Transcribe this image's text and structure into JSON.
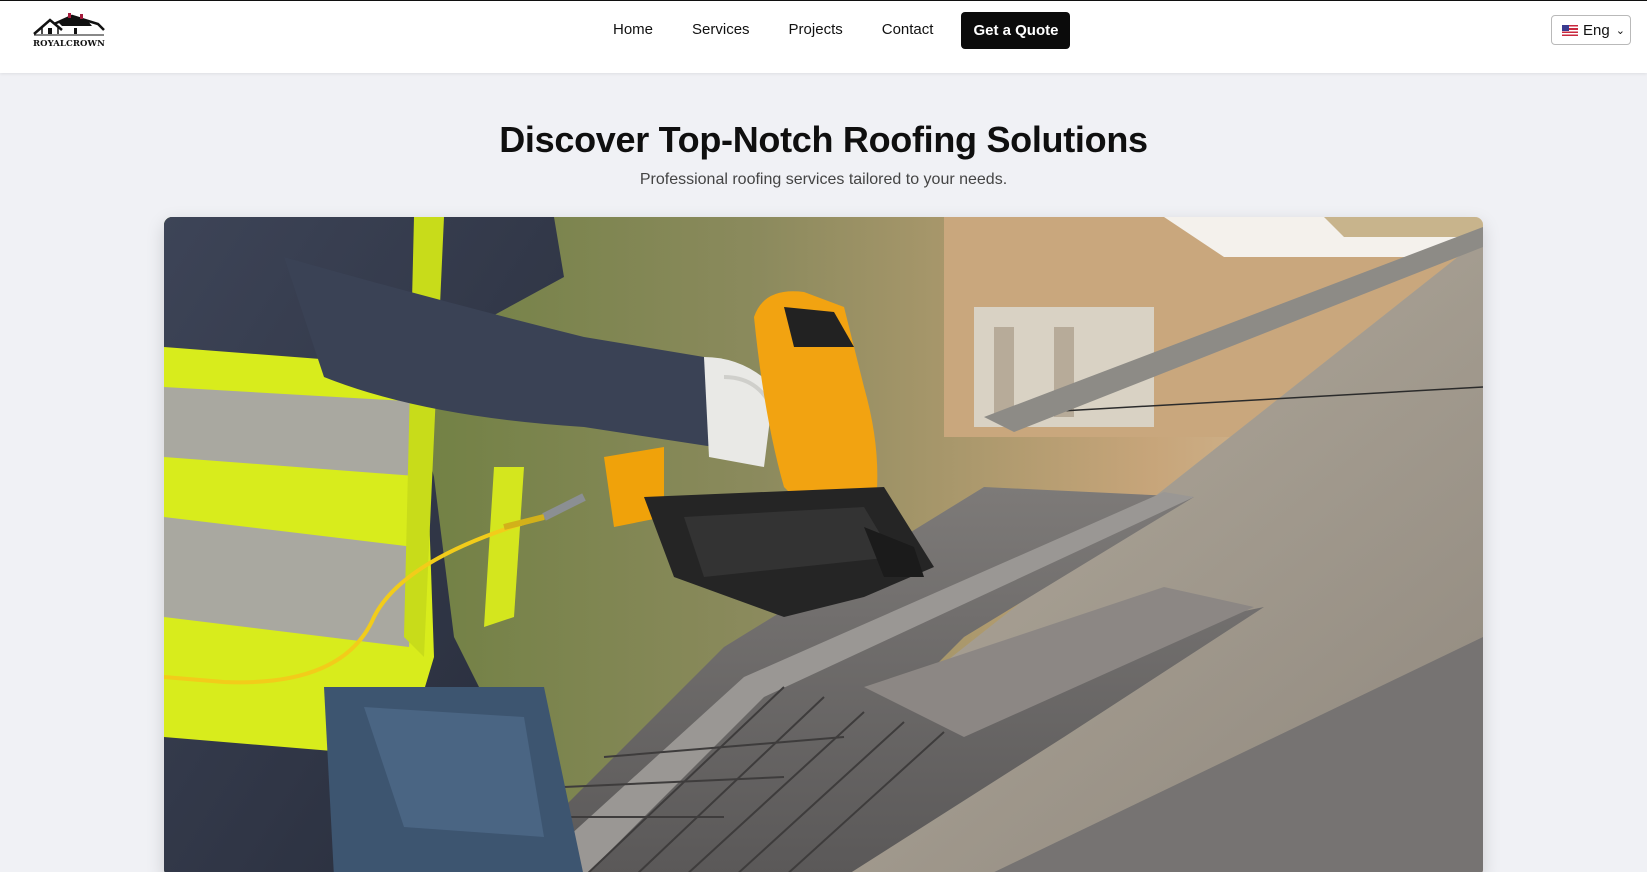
{
  "brand": {
    "name": "ROYALCROWN"
  },
  "nav": {
    "items": [
      {
        "label": "Home"
      },
      {
        "label": "Services"
      },
      {
        "label": "Projects"
      },
      {
        "label": "Contact"
      }
    ],
    "cta_label": "Get a Quote"
  },
  "language": {
    "selected": "Eng",
    "flag_icon": "us-flag-icon"
  },
  "hero": {
    "title": "Discover Top-Notch Roofing Solutions",
    "subtitle": "Professional roofing services tailored to your needs."
  },
  "colors": {
    "page_bg": "#f0f1f5",
    "header_bg": "#ffffff",
    "cta_bg": "#0b0b0b",
    "cta_text": "#ffffff"
  }
}
